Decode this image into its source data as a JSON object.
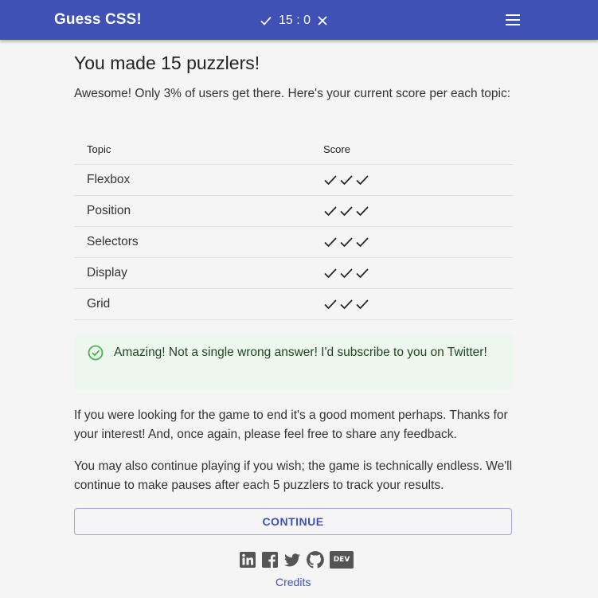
{
  "app": {
    "title": "Guess CSS!",
    "score": "15 : 0",
    "accent_color": "#3f51b5"
  },
  "result": {
    "heading": "You made 15 puzzlers!",
    "intro": "Awesome! Only 3% of users get there. Here's your current score per each topic:"
  },
  "table": {
    "headers": [
      "Topic",
      "Score"
    ],
    "rows": [
      {
        "topic": "Flexbox",
        "checks": 3
      },
      {
        "topic": "Position",
        "checks": 3
      },
      {
        "topic": "Selectors",
        "checks": 3
      },
      {
        "topic": "Display",
        "checks": 3
      },
      {
        "topic": "Grid",
        "checks": 3
      }
    ]
  },
  "alert": {
    "text": "Amazing! Not a single wrong answer! I'd subscribe to you on Twitter!",
    "color": "#edf7ed"
  },
  "paragraphs": [
    "If you were looking for the game to end it's a good moment perhaps. Thanks for your interest! And, once again, please feel free to share any feedback.",
    "You may also continue playing if you wish; the game is technically endless. We'll continue to make pauses after each 5 puzzlers to track your results."
  ],
  "continue_label": "CONTINUE",
  "social": {
    "icons": [
      "linkedin-icon",
      "facebook-icon",
      "twitter-icon",
      "github-icon",
      "dev-icon"
    ],
    "dev_label": "DEV"
  },
  "credits_label": "Credits"
}
